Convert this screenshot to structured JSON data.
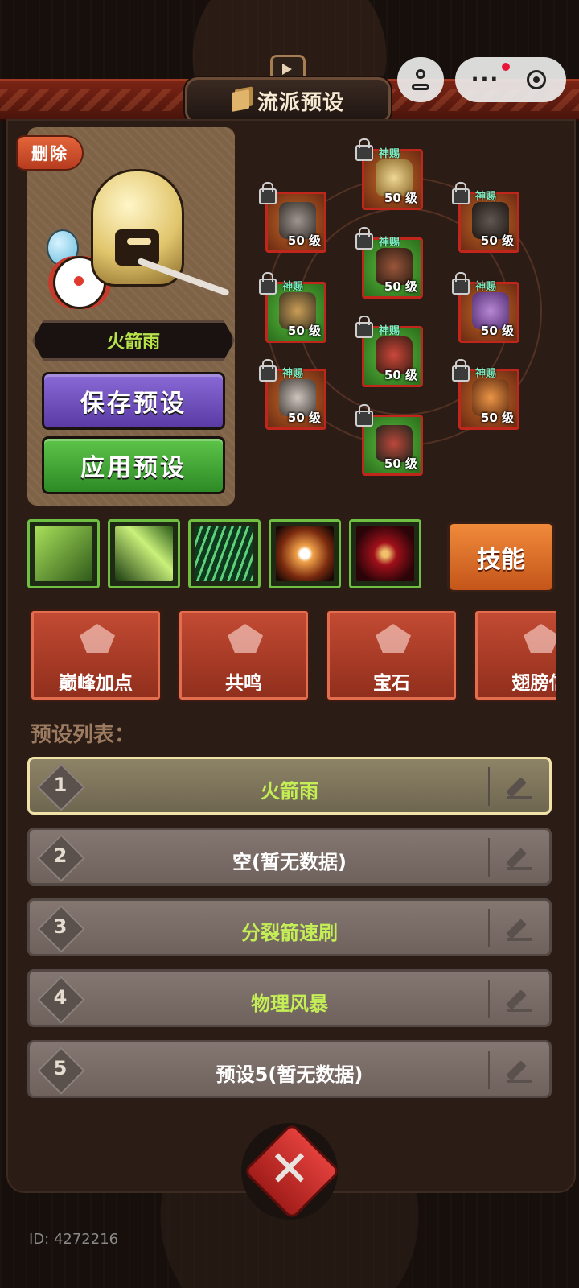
{
  "header": {
    "title": "流派预设"
  },
  "top_bar": {
    "more_dots": "···"
  },
  "hero": {
    "delete_label": "删除",
    "name": "火箭雨",
    "save_label": "保存预设",
    "apply_label": "应用预设"
  },
  "equipment": {
    "slots": [
      {
        "slot": "helmet",
        "level": "50 级",
        "badge": "神赐"
      },
      {
        "slot": "shoulder",
        "level": "50 级",
        "badge": ""
      },
      {
        "slot": "necklace",
        "level": "50 级",
        "badge": "神赐"
      },
      {
        "slot": "armor",
        "level": "50 级",
        "badge": "神赐"
      },
      {
        "slot": "gloves",
        "level": "50 级",
        "badge": "神赐"
      },
      {
        "slot": "ring",
        "level": "50 级",
        "badge": "神赐"
      },
      {
        "slot": "pants",
        "level": "50 级",
        "badge": "神赐"
      },
      {
        "slot": "bow",
        "level": "50 级",
        "badge": "神赐"
      },
      {
        "slot": "quiver",
        "level": "50 级",
        "badge": "神赐"
      },
      {
        "slot": "boots",
        "level": "50 级",
        "badge": ""
      }
    ]
  },
  "skills": {
    "button_label": "技能",
    "icons": [
      "arrow-skill",
      "leaf-skill",
      "rain-skill",
      "galaxy-skill",
      "shadow-skill"
    ]
  },
  "features": [
    {
      "label": "巅峰加点",
      "icon": "peak-icon"
    },
    {
      "label": "共鸣",
      "icon": "resonance-icon"
    },
    {
      "label": "宝石",
      "icon": "gem-icon"
    },
    {
      "label": "翅膀信",
      "icon": "wings-icon"
    }
  ],
  "preset_list": {
    "heading": "预设列表：",
    "items": [
      {
        "num": "1",
        "name": "火箭雨",
        "filled": true,
        "selected": true
      },
      {
        "num": "2",
        "name": "空(暂无数据)",
        "filled": false,
        "selected": false
      },
      {
        "num": "3",
        "name": "分裂箭速刷",
        "filled": true,
        "selected": false
      },
      {
        "num": "4",
        "name": "物理风暴",
        "filled": true,
        "selected": false
      },
      {
        "num": "5",
        "name": "预设5(暂无数据)",
        "filled": false,
        "selected": false
      }
    ]
  },
  "footer": {
    "emblem_glyph": "✕",
    "id_text": "ID: 4272216"
  },
  "colors": {
    "accent_green_text": "#c4ee56",
    "slot_border_red": "#c1261c",
    "save_purple": "#6d4dbb",
    "apply_green": "#3fa832",
    "skill_orange": "#e0742c"
  }
}
